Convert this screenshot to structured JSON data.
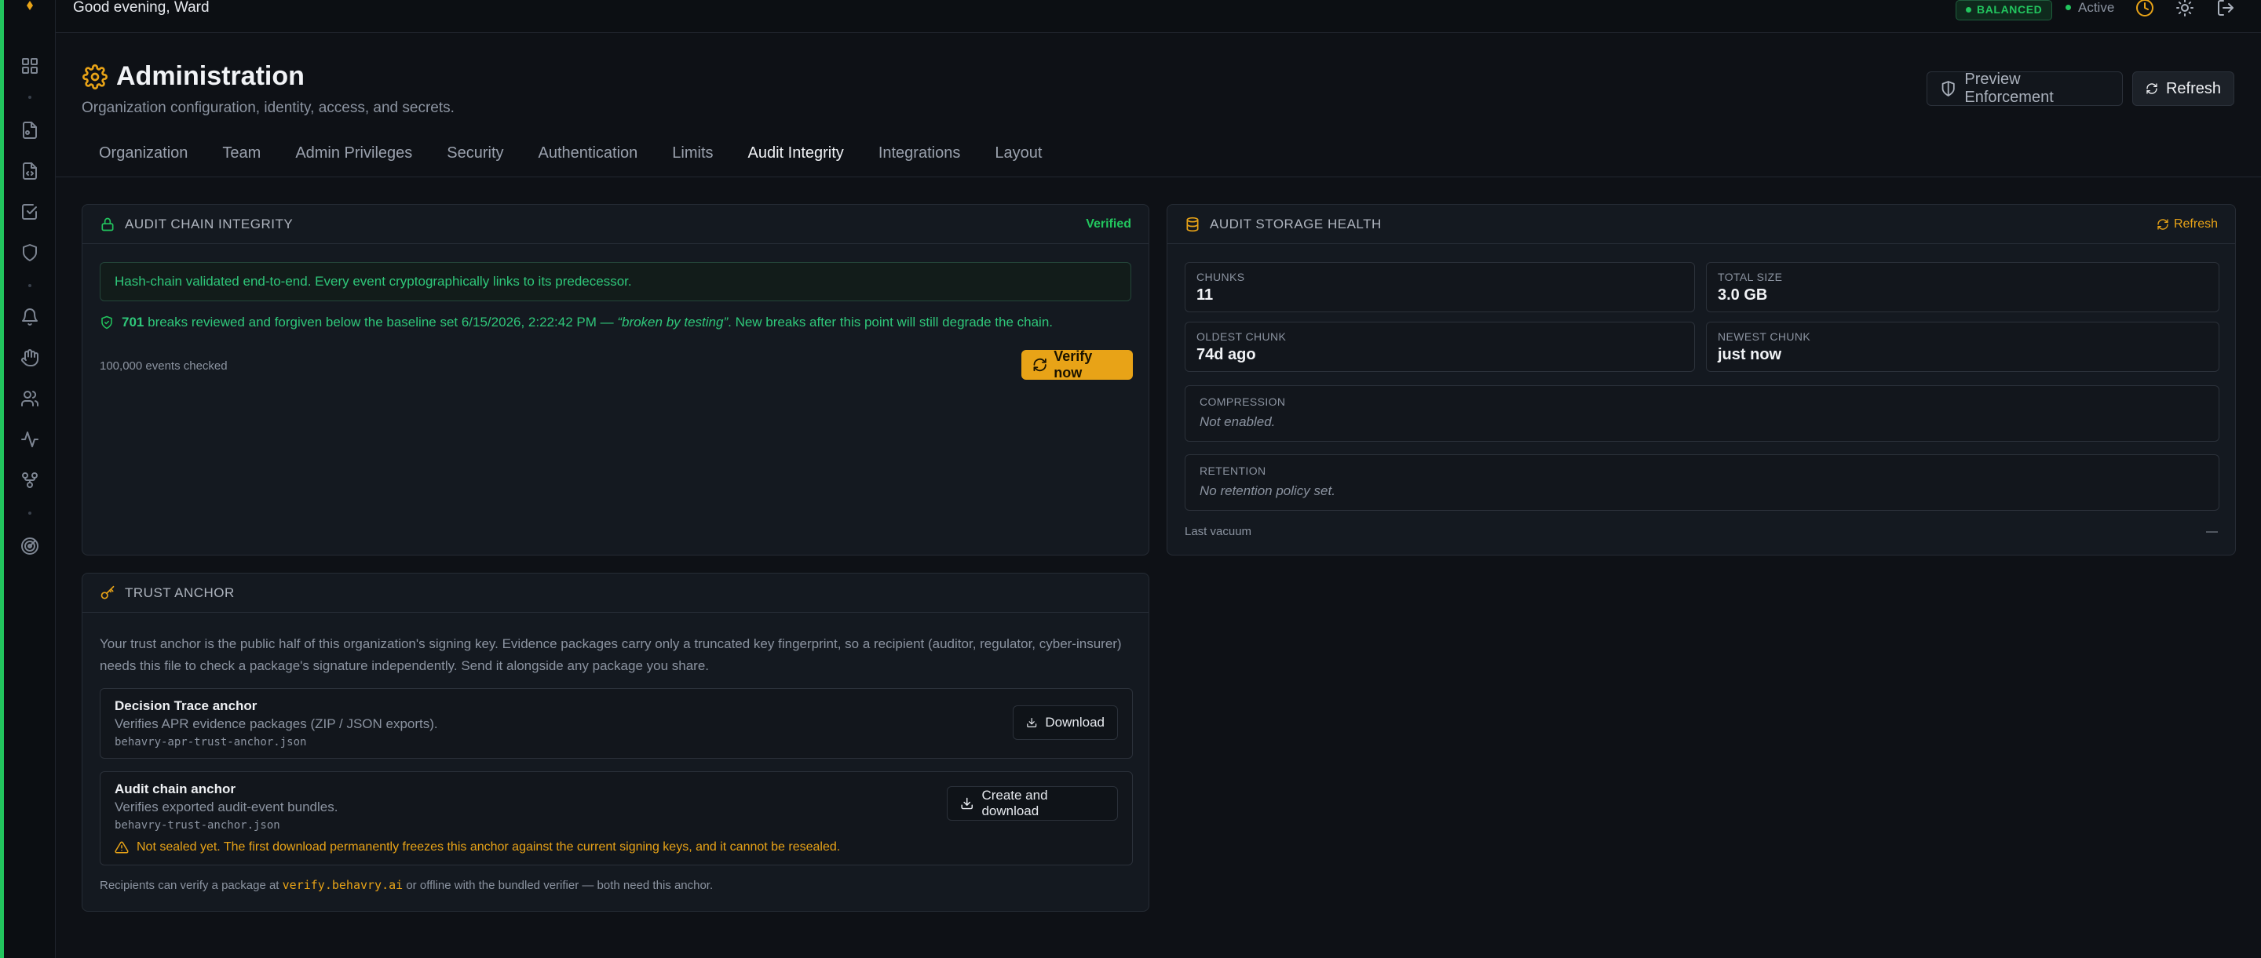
{
  "topbar": {
    "greeting": "Good evening, Ward",
    "mode_badge": "BALANCED",
    "status": "Active"
  },
  "header": {
    "title": "Administration",
    "subtitle": "Organization configuration, identity, access, and secrets.",
    "preview_label": "Preview Enforcement",
    "refresh_label": "Refresh"
  },
  "tabs": [
    {
      "label": "Organization"
    },
    {
      "label": "Team"
    },
    {
      "label": "Admin Privileges"
    },
    {
      "label": "Security"
    },
    {
      "label": "Authentication"
    },
    {
      "label": "Limits"
    },
    {
      "label": "Audit Integrity",
      "active": true
    },
    {
      "label": "Integrations"
    },
    {
      "label": "Layout"
    }
  ],
  "chain": {
    "title": "AUDIT CHAIN INTEGRITY",
    "status": "Verified",
    "validated_msg": "Hash-chain validated end-to-end. Every event cryptographically links to its predecessor.",
    "breaks_count": "701",
    "breaks_text": "breaks reviewed and forgiven below the baseline set 6/15/2026, 2:22:42 PM —",
    "breaks_reason": "“broken by testing”",
    "breaks_tail": ". New breaks after this point will still degrade the chain.",
    "events_checked": "100,000 events checked",
    "verify_label": "Verify now"
  },
  "storage": {
    "title": "AUDIT STORAGE HEALTH",
    "refresh_label": "Refresh",
    "chunks_label": "CHUNKS",
    "chunks_value": "11",
    "size_label": "TOTAL SIZE",
    "size_value": "3.0 GB",
    "oldest_label": "OLDEST CHUNK",
    "oldest_value": "74d ago",
    "newest_label": "NEWEST CHUNK",
    "newest_value": "just now",
    "compression_label": "COMPRESSION",
    "compression_value": "Not enabled.",
    "retention_label": "RETENTION",
    "retention_value": "No retention policy set.",
    "vacuum_label": "Last vacuum",
    "vacuum_value": "—"
  },
  "trust": {
    "title": "TRUST ANCHOR",
    "intro_1": "Your trust anchor is the public half of this organization's signing key. Evidence packages carry only a truncated key fingerprint, so a recipient (auditor, regulator, cyber-insurer)",
    "intro_2": "needs this file to check a package's signature independently. Send it alongside any package you share.",
    "decision_title": "Decision Trace anchor",
    "decision_desc": "Verifies APR evidence packages (ZIP / JSON exports).",
    "decision_file": "behavry-apr-trust-anchor.json",
    "decision_btn": "Download",
    "audit_title": "Audit chain anchor",
    "audit_desc": "Verifies exported audit-event bundles.",
    "audit_file": "behavry-trust-anchor.json",
    "audit_btn": "Create and download",
    "audit_warning": "Not sealed yet. The first download permanently freezes this anchor against the current signing keys, and it cannot be resealed.",
    "footer_pre": "Recipients can verify a package at",
    "footer_link": "verify.behavry.ai",
    "footer_post": "or offline with the bundled verifier — both need this anchor."
  }
}
